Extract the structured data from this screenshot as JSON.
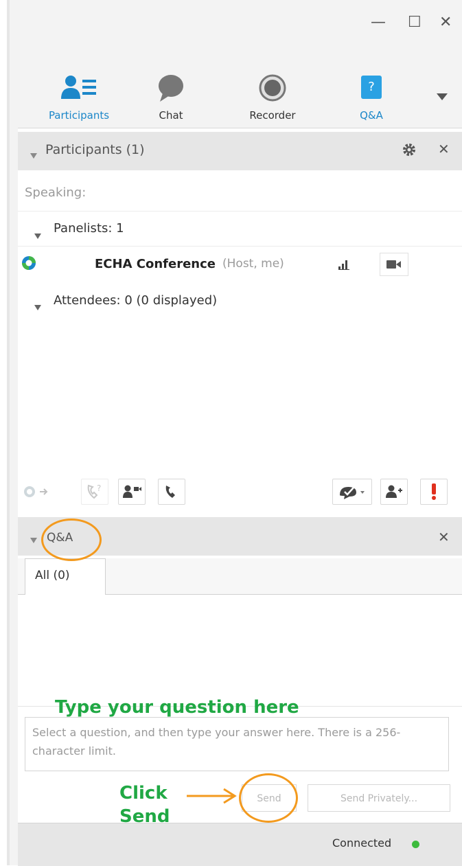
{
  "window": {
    "minimize_glyph": "—",
    "maximize_glyph": "☐",
    "close_glyph": "✕"
  },
  "toolbar": {
    "items": [
      {
        "label": "Participants",
        "icon": "participants-icon",
        "active": true
      },
      {
        "label": "Chat",
        "icon": "chat-icon",
        "active": false
      },
      {
        "label": "Recorder",
        "icon": "recorder-icon",
        "active": false
      },
      {
        "label": "Q&A",
        "icon": "qa-icon",
        "active": true
      }
    ],
    "qa_icon_glyph": "?",
    "overflow_icon": "chevron-down-icon"
  },
  "participants_panel": {
    "title": "Participants (1)",
    "speaking_label": "Speaking:",
    "panelists_label": "Panelists: 1",
    "panelist": {
      "name": "ECHA Conference",
      "role": "(Host, me)"
    },
    "attendees_label": "Attendees: 0 (0 displayed)"
  },
  "qa_panel": {
    "title": "Q&A",
    "tab_label": "All (0)",
    "input_placeholder": "Select a question, and then type your answer here. There is a 256-character limit.",
    "send_label": "Send",
    "send_privately_label": "Send Privately..."
  },
  "status": {
    "text": "Connected",
    "indicator_color": "#3dbb3d"
  },
  "annotations": {
    "type_question": "Type your question here",
    "click_send_line1": "Click",
    "click_send_line2": "Send",
    "highlight_color": "#f39a1e",
    "text_color": "#20a844"
  },
  "colors": {
    "accent_blue": "#1c87c9",
    "alert_red": "#e0301e"
  }
}
